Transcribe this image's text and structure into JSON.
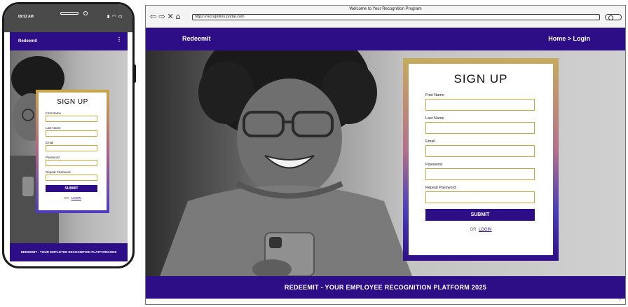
{
  "phone": {
    "status_time": "09:52 AM",
    "brand": "Redeemit",
    "menu_icon": "kebab-menu-icon",
    "form": {
      "title": "SIGN UP",
      "labels": [
        "First Name",
        "Last Name",
        "Email",
        "Password",
        "Repeat Password"
      ],
      "submit": "SUBMIT",
      "or_text": "OR",
      "login_link": "LOGIN"
    },
    "footer": "REDEEMIT - YOUR EMPLOYEE RECOGNITION PLATFORM 2025"
  },
  "browser": {
    "window_title": "Welcome to Your Recognition Program",
    "url": "https://recognition.portal.com",
    "nav_icons": [
      "back-arrow-icon",
      "forward-arrow-icon",
      "close-x-icon",
      "home-icon"
    ],
    "brand": "Redeemit",
    "breadcrumb": "Home > Login",
    "form": {
      "title": "SIGN UP",
      "labels": [
        "First Name",
        "Last Name",
        "Email",
        "Password",
        "Repeat Password"
      ],
      "submit": "SUBMIT",
      "or_text": "OR",
      "login_link": "LOGIN"
    },
    "footer": "REDEEMIT - YOUR EMPLOYEE RECOGNITION PLATFORM 2025"
  },
  "colors": {
    "primary": "#2e0e87",
    "field_border": "#c9a93a",
    "card_gradient_top": "#c6ab5c",
    "card_gradient_bottom": "#2e0e87"
  }
}
